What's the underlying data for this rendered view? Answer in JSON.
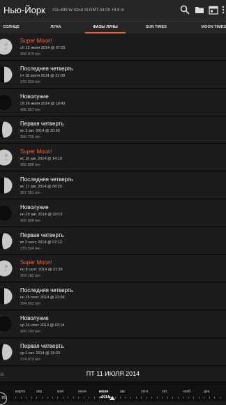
{
  "header": {
    "city": "Нью-Йорк",
    "address": "411-499 W 42nd St   GMT-04:00   +9.6 m",
    "icons": [
      "search-icon",
      "folder-icon",
      "calendar-icon",
      "more-icon"
    ]
  },
  "tabs": [
    {
      "label": "СОЛНЦЕ"
    },
    {
      "label": "ЛУНА"
    },
    {
      "label": "ФАЗЫ ЛУНЫ"
    },
    {
      "label": "SUN TIMES"
    },
    {
      "label": "MOON TIMES"
    }
  ],
  "active_tab": "ФАЗЫ ЛУНЫ",
  "accent_color": "#f1683c",
  "phases": [
    {
      "title": "Super Moon!",
      "date": "сб 12 июля 2014 @ 07:25",
      "distance": "358 975 km",
      "super": true,
      "phase": "full"
    },
    {
      "title": "Последняя четверть",
      "date": "пт 18 июля 2014 @ 22:09",
      "distance": "379 926 km",
      "super": false,
      "phase": "last"
    },
    {
      "title": "Новолуние",
      "date": "сб 26 июля 2014 @ 18:42",
      "distance": "406 057 km",
      "super": false,
      "phase": "new"
    },
    {
      "title": "Первая четверть",
      "date": "вс  3 авг. 2014 @ 20:50",
      "distance": "386 755 km",
      "super": false,
      "phase": "first"
    },
    {
      "title": "Super Moon!",
      "date": "вс 10 авг. 2014 @ 14:10",
      "distance": "356 898 km",
      "super": true,
      "phase": "full"
    },
    {
      "title": "Последняя четверть",
      "date": "вс 17 авг. 2014 @ 08:26",
      "distance": "387 301 km",
      "super": false,
      "phase": "last"
    },
    {
      "title": "Новолуние",
      "date": "пн 25 авг. 2014 @ 10:13",
      "distance": "405 908 km",
      "super": false,
      "phase": "new"
    },
    {
      "title": "Первая четверть",
      "date": "вт  2 сент. 2014 @ 07:12",
      "distance": "379 594 km",
      "super": false,
      "phase": "first"
    },
    {
      "title": "Super Moon!",
      "date": "пн  8 сент. 2014 @ 21:39",
      "distance": "359 182 km",
      "super": true,
      "phase": "full"
    },
    {
      "title": "Последняя четверть",
      "date": "пн 15 сент. 2014 @ 22:06",
      "distance": "394 952 km",
      "super": false,
      "phase": "last"
    },
    {
      "title": "Новолуние",
      "date": "ср 24 сент. 2014 @ 02:14",
      "distance": "400 743 km",
      "super": false,
      "phase": "new"
    },
    {
      "title": "Первая четверть",
      "date": "ср  1 окт. 2014 @ 15:33",
      "distance": "374 073 km",
      "super": false,
      "phase": "first"
    }
  ],
  "bottom": {
    "current_date": "ПТ 11 ИЮЛЯ 2014",
    "year_left": "35",
    "circle_label": "65",
    "months": [
      "марта",
      "апр.",
      "мая",
      "июня",
      "июля",
      "авг.",
      "сент.",
      "окт.",
      "нояб.",
      "дек."
    ],
    "year_marker": "◂2014▸",
    "active_month": "июля"
  }
}
